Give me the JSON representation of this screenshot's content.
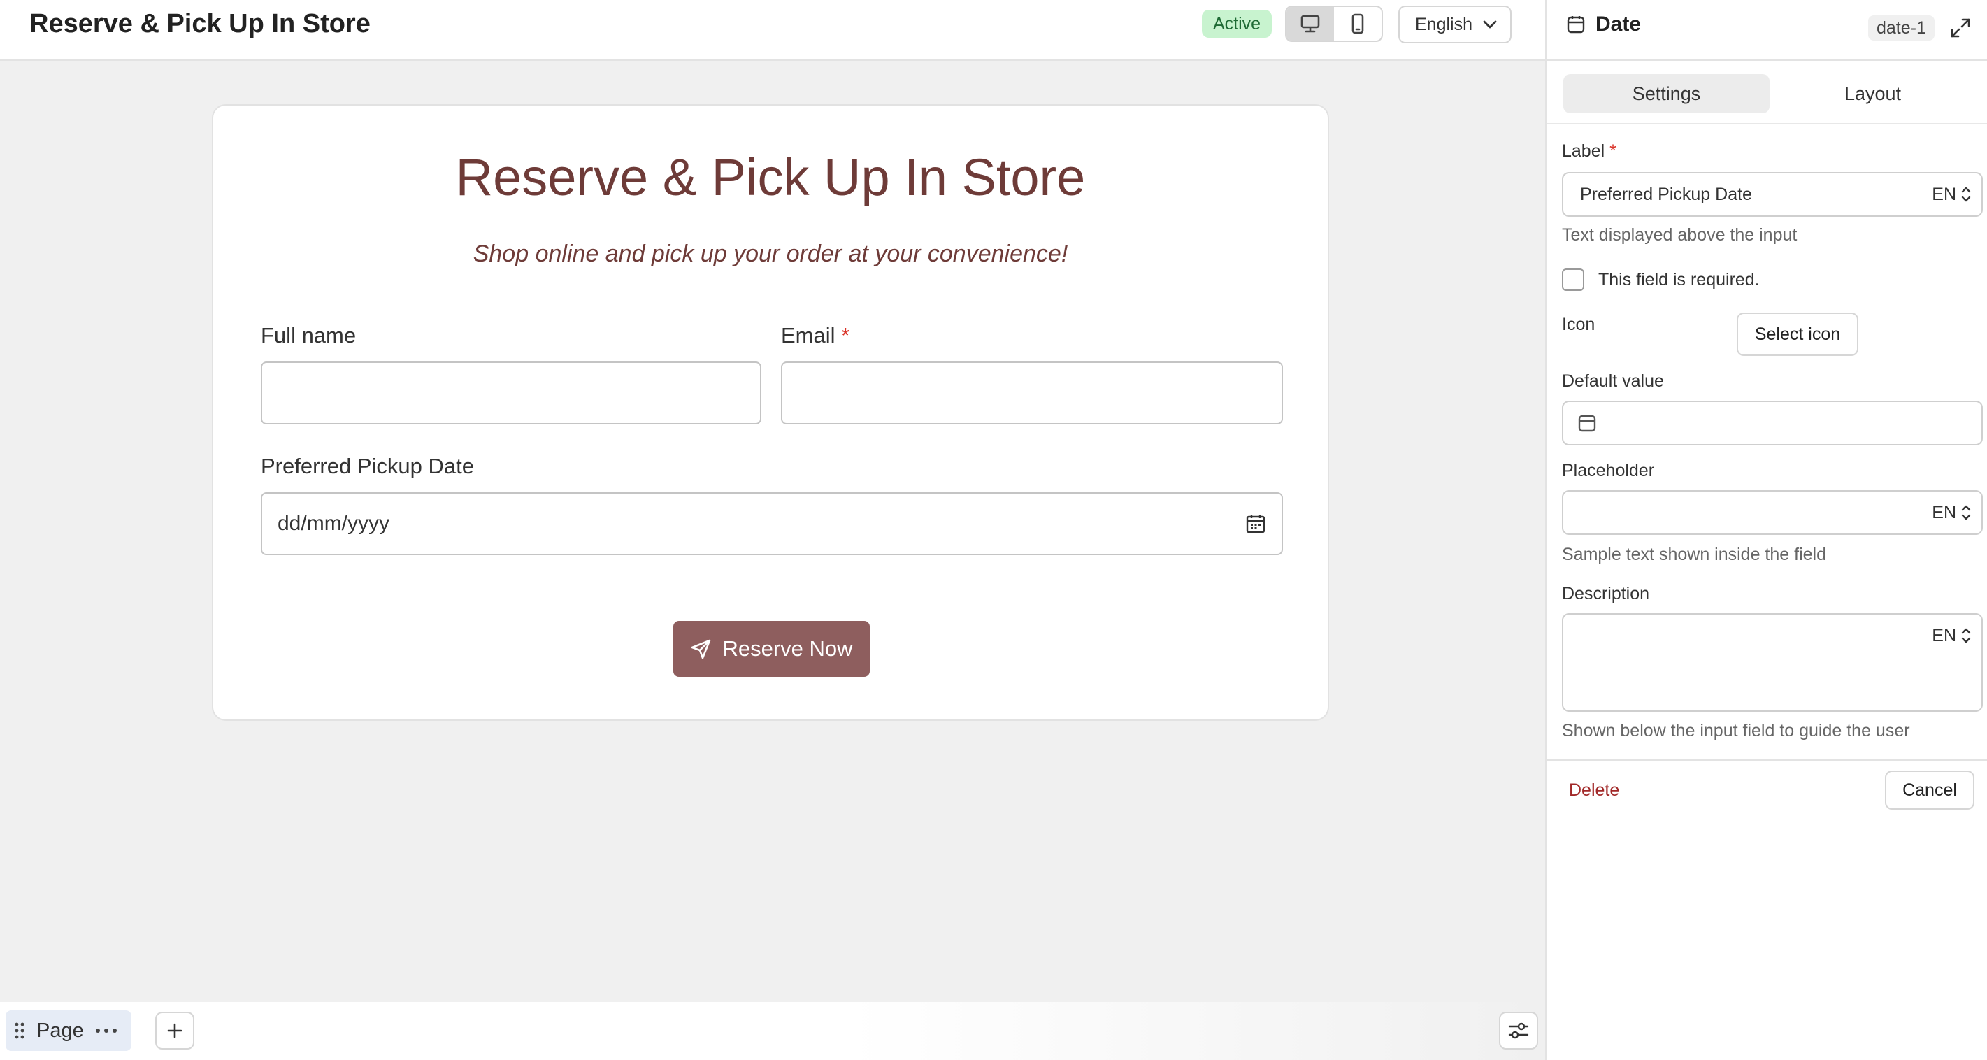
{
  "topbar": {
    "app_title": "Reserve & Pick Up In Store",
    "status": "Active",
    "status_color": "#1f6b35",
    "device_options": [
      "desktop-icon",
      "mobile-icon"
    ],
    "device_selected": "desktop",
    "language": "English"
  },
  "form": {
    "title": "Reserve & Pick Up In Store",
    "subtitle": "Shop online and pick up your order at your convenience!",
    "accent_color": "#6e3b38",
    "fields": {
      "full_name": {
        "label": "Full name",
        "value": ""
      },
      "email": {
        "label": "Email",
        "required_mark": "*",
        "value": ""
      },
      "pickup_date": {
        "label": "Preferred Pickup Date",
        "placeholder": "dd/mm/yyyy",
        "icon": "calendar-icon"
      }
    },
    "submit_label": "Reserve Now",
    "submit_icon": "send-icon",
    "submit_color": "#8e5e5e"
  },
  "bottombar": {
    "page_label": "Page",
    "add_label": "+"
  },
  "panel": {
    "title": "Date",
    "title_icon": "calendar-icon",
    "field_id": "date-1",
    "tabs": [
      "Settings",
      "Layout"
    ],
    "active_tab": "Settings",
    "label": {
      "title": "Label",
      "required_mark": "*",
      "value": "Preferred Pickup Date",
      "lang": "EN",
      "help": "Text displayed above the input"
    },
    "required": {
      "label": "This field is required.",
      "checked": false
    },
    "icon": {
      "title": "Icon",
      "button": "Select icon"
    },
    "default_value": {
      "title": "Default value",
      "value": ""
    },
    "placeholder": {
      "title": "Placeholder",
      "value": "",
      "lang": "EN",
      "help": "Sample text shown inside the field"
    },
    "description": {
      "title": "Description",
      "value": "",
      "lang": "EN",
      "help": "Shown below the input field to guide the user"
    },
    "delete_label": "Delete",
    "cancel_label": "Cancel"
  }
}
